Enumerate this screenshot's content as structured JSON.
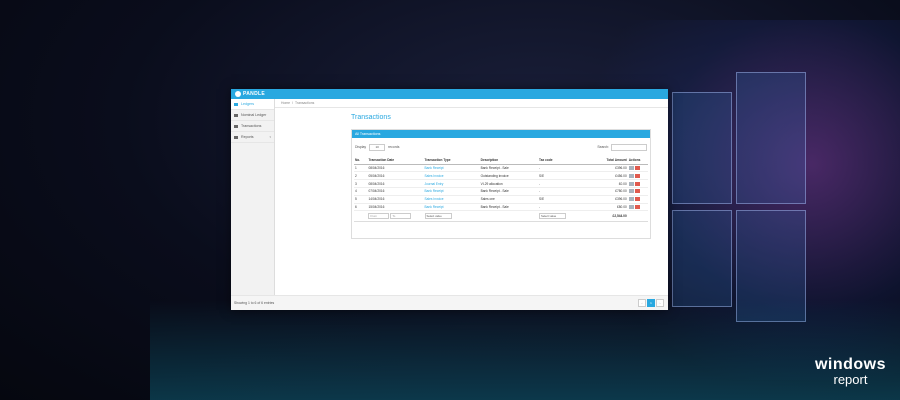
{
  "app": {
    "brand": "PANDLE",
    "breadcrumb": [
      "Home",
      "Transactions"
    ],
    "page_title": "Transactions"
  },
  "sidebar": {
    "items": [
      {
        "label": "Ledgers",
        "active": true
      },
      {
        "label": "Nominal Ledger",
        "active": false
      },
      {
        "label": "Transactions",
        "active": false
      },
      {
        "label": "Reports",
        "active": false
      }
    ]
  },
  "panel": {
    "title": "All Transactions",
    "display_label": "Display",
    "records_label": "records",
    "page_length": "10",
    "search_label": "Search:"
  },
  "table": {
    "headers": [
      "No.",
      "Transaction Date",
      "Transaction Type",
      "Description",
      "Tax code",
      "Total Amount",
      "Actions"
    ],
    "rows": [
      [
        "1",
        "08/04/2016",
        "Bank Receipt",
        "Bank Receipt - Sale",
        "-",
        "£396.00"
      ],
      [
        "2",
        "05/04/2016",
        "Sales Invoice",
        "Outstanding invoice",
        "S/E",
        "£456.00"
      ],
      [
        "3",
        "08/04/2016",
        "Journal Entry",
        "VI-29 allocation",
        "-",
        "£0.00"
      ],
      [
        "4",
        "07/04/2016",
        "Bank Receipt",
        "Bank Receipt - Sale",
        "-",
        "£780.00"
      ],
      [
        "5",
        "14/04/2016",
        "Sales Invoice",
        "Sales one",
        "S/E",
        "£396.00"
      ],
      [
        "6",
        "15/04/2016",
        "Bank Receipt",
        "Bank Receipt - Sale",
        "-",
        "£80.00"
      ]
    ],
    "filters": {
      "from_placeholder": "From",
      "to_placeholder": "To",
      "type_select": "Select value",
      "tax_select": "Select value",
      "total": "£2,544.00"
    },
    "info": "Showing 1 to 6 of 6 entries",
    "pages": [
      "‹",
      "1",
      "›"
    ]
  },
  "watermark": {
    "line1": "windows",
    "line2": "report"
  }
}
